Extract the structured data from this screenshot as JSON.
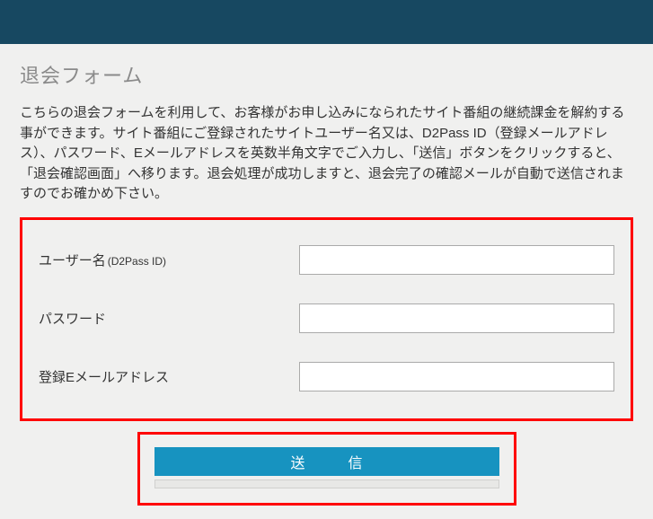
{
  "page": {
    "title": "退会フォーム",
    "description": "こちらの退会フォームを利用して、お客様がお申し込みになられたサイト番組の継続課金を解約する事ができます。サイト番組にご登録されたサイトユーザー名又は、D2Pass ID（登録メールアドレス）、パスワード、Eメールアドレスを英数半角文字でご入力し、「送信」ボタンをクリックすると、「退会確認画面」へ移ります。退会処理が成功しますと、退会完了の確認メールが自動で送信されますのでお確かめ下さい。"
  },
  "form": {
    "fields": {
      "username": {
        "label": "ユーザー名",
        "label_sub": "(D2Pass ID)",
        "value": ""
      },
      "password": {
        "label": "パスワード",
        "value": ""
      },
      "email": {
        "label": "登録Eメールアドレス",
        "value": ""
      }
    },
    "submit_label": "送　信"
  }
}
